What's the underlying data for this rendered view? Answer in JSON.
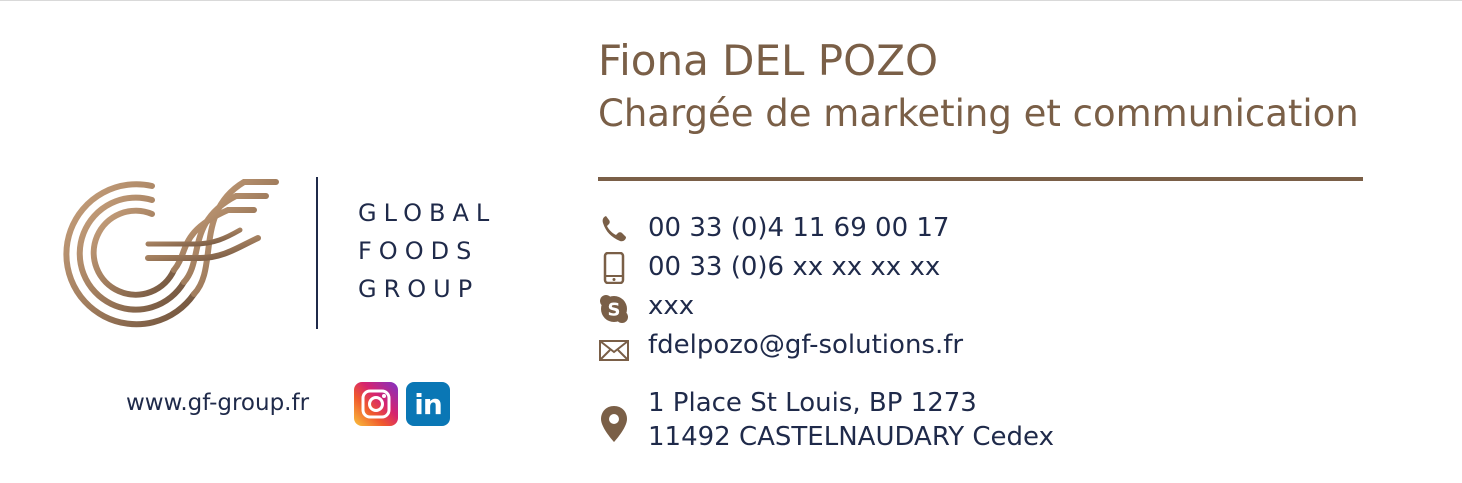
{
  "logo": {
    "word_lines": [
      "GLOBAL",
      "FOODS",
      "GROUP"
    ],
    "colors": {
      "gold_light": "#c9a27e",
      "gold_dark": "#7a5f47",
      "navy": "#1f2a4a"
    }
  },
  "website": "www.gf-group.fr",
  "social": [
    {
      "icon": "instagram-icon"
    },
    {
      "icon": "linkedin-icon",
      "glyph": "in"
    }
  ],
  "person": {
    "name": "Fiona DEL POZO",
    "role": "Chargée de marketing et communication"
  },
  "contacts": {
    "phone": "00 33 (0)4 11 69 00 17",
    "mobile": "00 33 (0)6 xx xx xx xx",
    "skype": "xxx",
    "email": "fdelpozo@gf-solutions.fr",
    "address_line1": "1 Place St Louis, BP 1273",
    "address_line2": "11492 CASTELNAUDARY Cedex"
  },
  "colors": {
    "brown": "#7a5f47",
    "navy": "#1f2a4a",
    "linkedin_blue": "#0a77b5"
  }
}
